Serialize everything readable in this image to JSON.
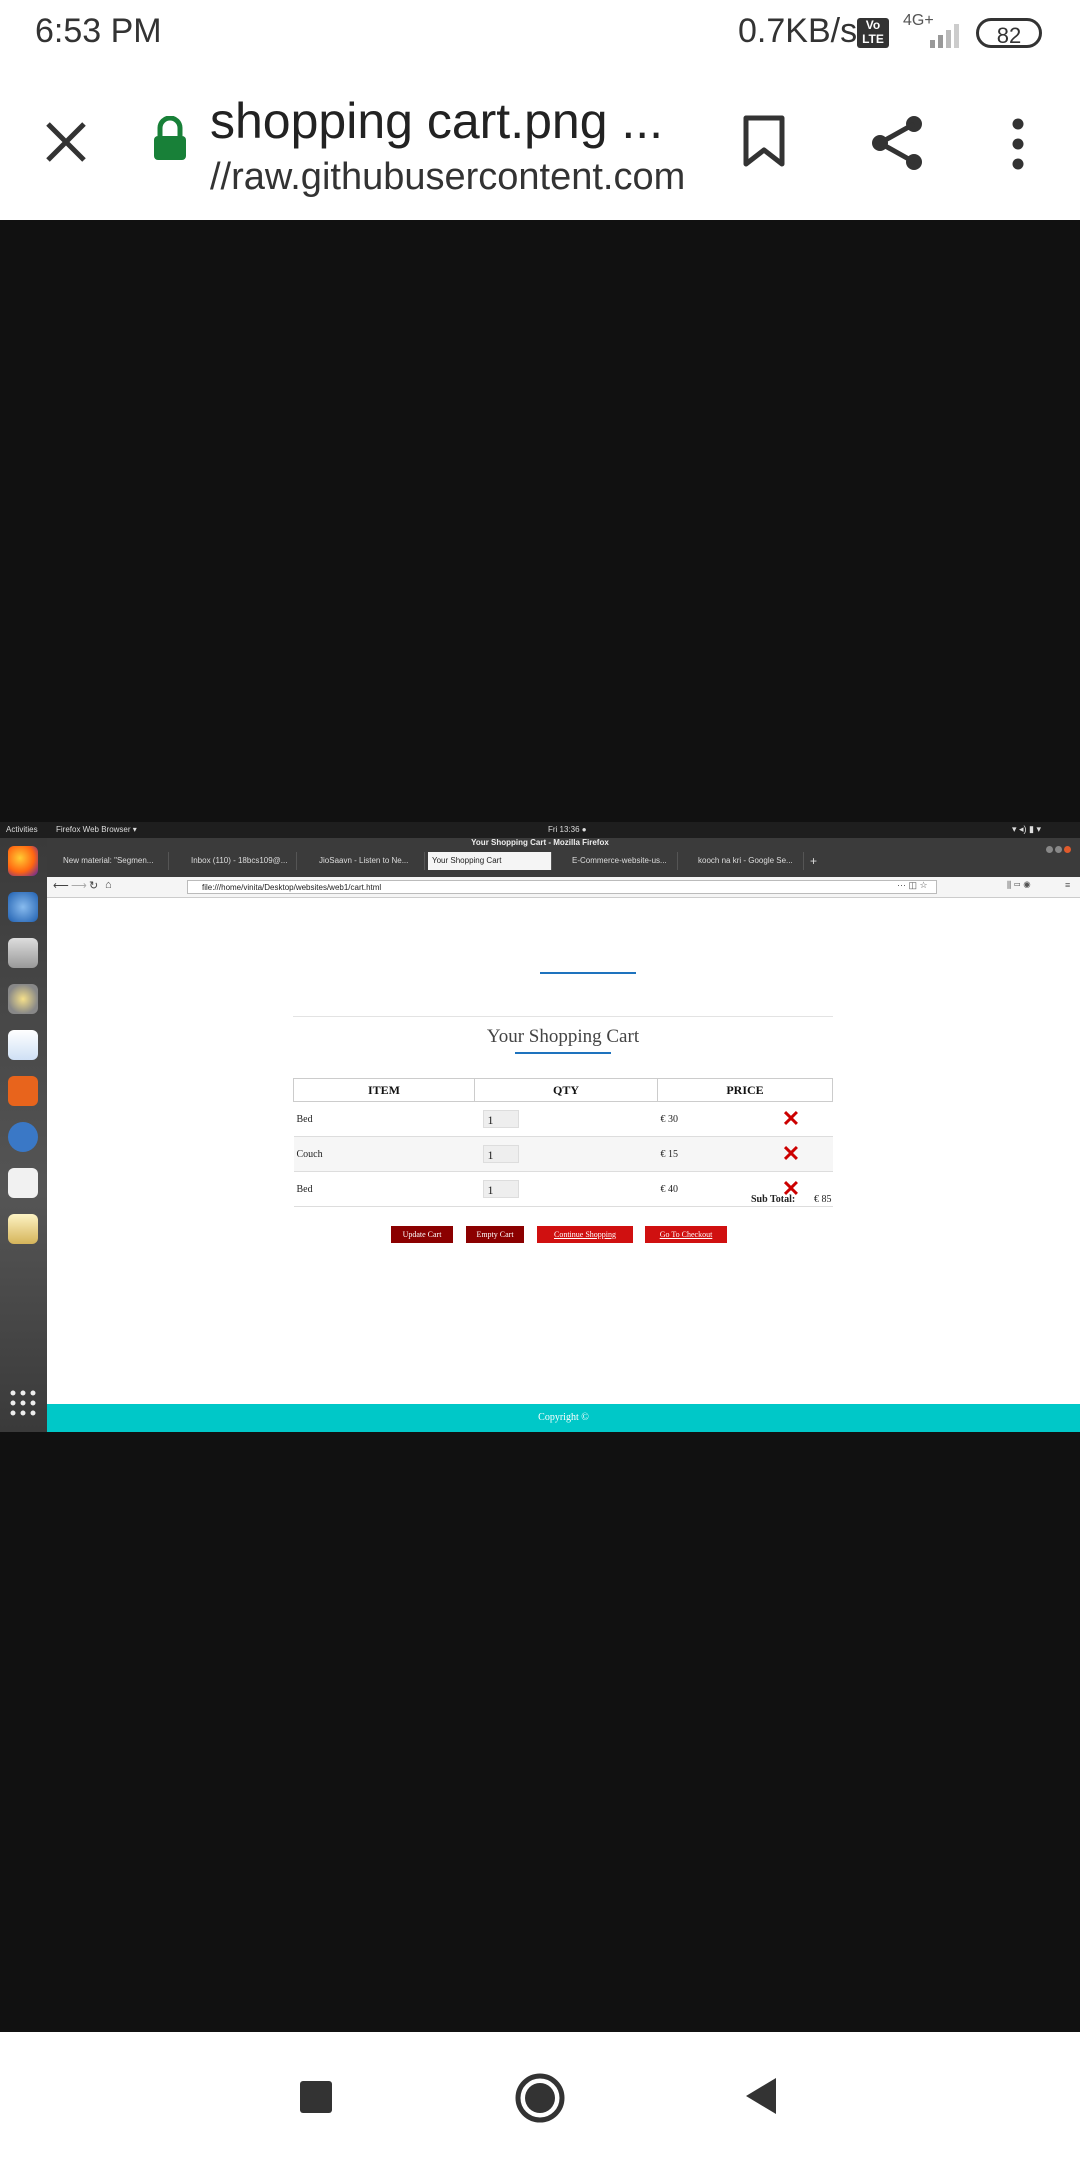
{
  "status_bar": {
    "time": "6:53 PM",
    "net_speed": "0.7KB/s",
    "volte_badge": "Vo LTE",
    "network_type": "4G+",
    "battery": "82"
  },
  "browser": {
    "title": "shopping cart.png ...",
    "url": "//raw.githubusercontent.com",
    "icons": [
      "close-icon",
      "lock-icon",
      "bookmark-icon",
      "share-icon",
      "more-icon"
    ]
  },
  "desktop": {
    "activities": "Activities",
    "app_menu": "Firefox Web Browser ▾",
    "clock": "Fri 13:36 ●",
    "window_title": "Your Shopping Cart - Mozilla Firefox",
    "tabs": [
      {
        "label": "New material: \"Segmen..."
      },
      {
        "label": "Inbox (110) - 18bcs109@..."
      },
      {
        "label": "JioSaavn - Listen to Ne..."
      },
      {
        "label": "Your Shopping Cart"
      },
      {
        "label": "E-Commerce-website-us..."
      },
      {
        "label": "kooch na kri - Google Se..."
      }
    ],
    "address": "file:///home/vinita/Desktop/websites/web1/cart.html",
    "new_tab": "+"
  },
  "cart_page": {
    "heading": "Your Shopping Cart",
    "columns": [
      "ITEM",
      "QTY",
      "PRICE"
    ],
    "rows": [
      {
        "item": "Bed",
        "qty": "1",
        "price": "€ 30"
      },
      {
        "item": "Couch",
        "qty": "1",
        "price": "€ 15"
      },
      {
        "item": "Bed",
        "qty": "1",
        "price": "€ 40"
      }
    ],
    "subtotal_label": "Sub Total:",
    "subtotal_value": "€ 85",
    "buttons": {
      "update": "Update Cart",
      "empty": "Empty Cart",
      "continue": "Continue Shopping",
      "checkout": "Go To Checkout"
    },
    "footer": "Copyright ©"
  },
  "colors": {
    "accent_line": "#1e73be",
    "dark_button": "#8b0000",
    "red_button": "#d01010",
    "footer": "#00c8c8",
    "remove_icon": "#cc0000"
  }
}
